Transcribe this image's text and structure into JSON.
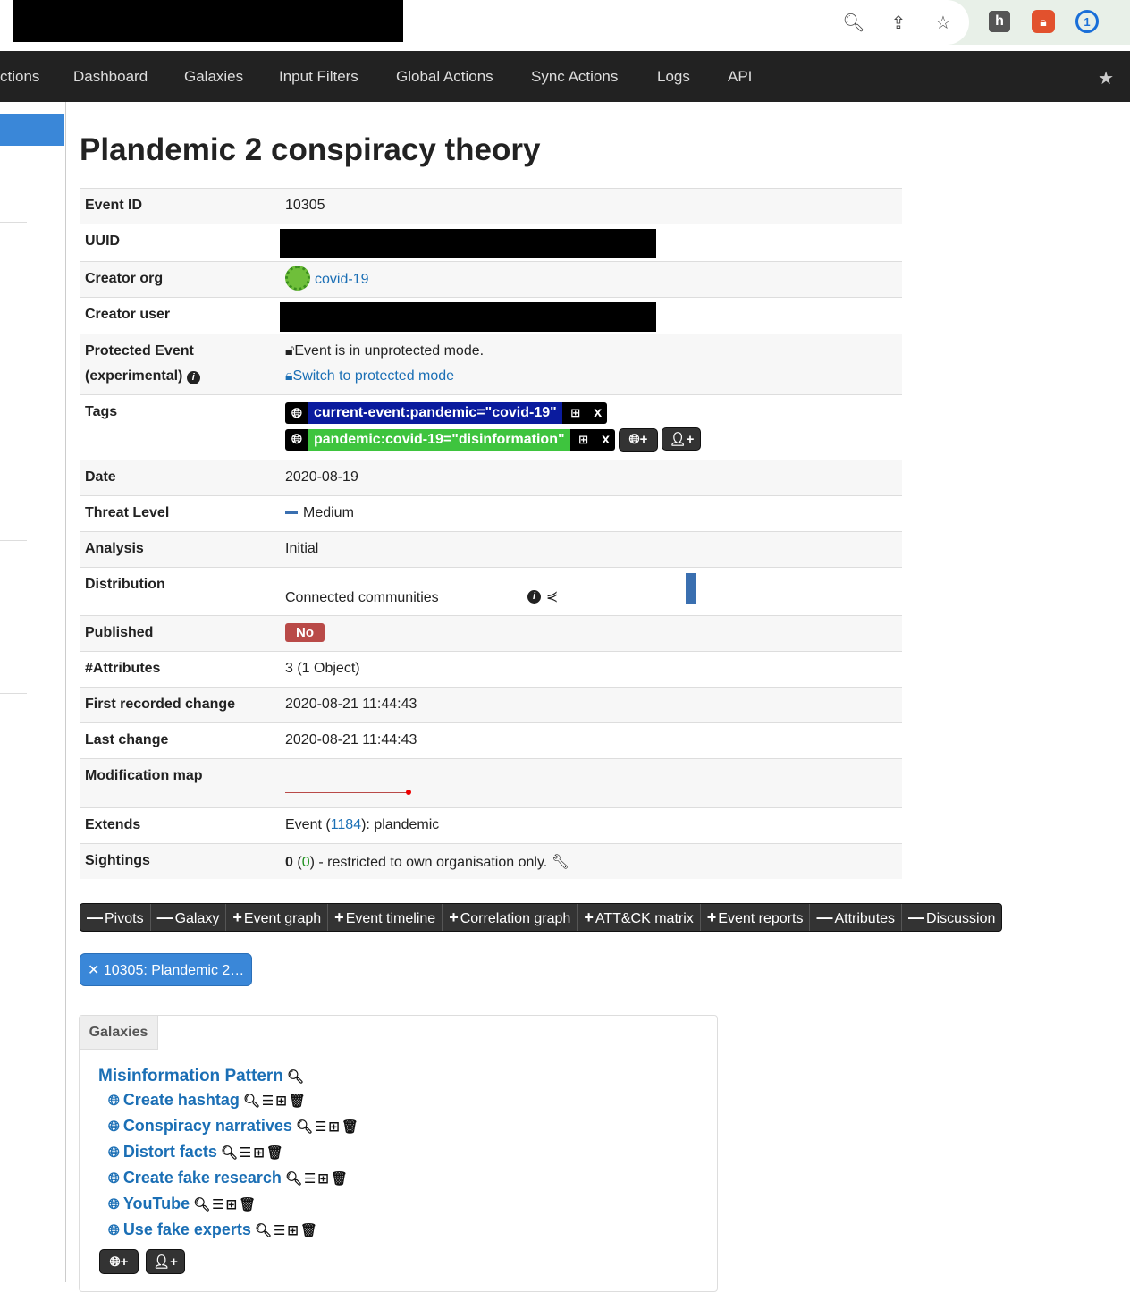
{
  "nav": {
    "items": [
      "ctions",
      "Dashboard",
      "Galaxies",
      "Input Filters",
      "Global Actions",
      "Sync Actions",
      "Logs",
      "API"
    ]
  },
  "page": {
    "title": "Plandemic 2 conspiracy theory"
  },
  "event": {
    "event_id_label": "Event ID",
    "event_id": "10305",
    "uuid_label": "UUID",
    "creator_org_label": "Creator org",
    "creator_org": "covid-19",
    "creator_user_label": "Creator user",
    "protected_label_1": "Protected Event",
    "protected_label_2": "(experimental)",
    "protected_status": "Event is in unprotected mode.",
    "protected_switch": "Switch to protected mode",
    "tags_label": "Tags",
    "tag_1": "current-event:pandemic=\"covid-19\"",
    "tag_2": "pandemic:covid-19=\"disinformation\"",
    "tag_remove": "x",
    "date_label": "Date",
    "date": "2020-08-19",
    "threat_label": "Threat Level",
    "threat": "Medium",
    "analysis_label": "Analysis",
    "analysis": "Initial",
    "distribution_label": "Distribution",
    "distribution": "Connected communities",
    "published_label": "Published",
    "published": "No",
    "attributes_label": "#Attributes",
    "attributes": "3 (1 Object)",
    "first_change_label": "First recorded change",
    "first_change": "2020-08-21 11:44:43",
    "last_change_label": "Last change",
    "last_change": "2020-08-21 11:44:43",
    "mod_map_label": "Modification map",
    "extends_label": "Extends",
    "extends_prefix": "Event (",
    "extends_id": "1184",
    "extends_suffix": "): plandemic",
    "sightings_label": "Sightings",
    "sightings_count": "0",
    "sightings_sub": "0",
    "sightings_text": " - restricted to own organisation only."
  },
  "tabs": [
    {
      "sign": "—",
      "label": "Pivots"
    },
    {
      "sign": "—",
      "label": "Galaxy"
    },
    {
      "sign": "+",
      "label": "Event graph"
    },
    {
      "sign": "+",
      "label": "Event timeline"
    },
    {
      "sign": "+",
      "label": "Correlation graph"
    },
    {
      "sign": "+",
      "label": "ATT&CK matrix"
    },
    {
      "sign": "+",
      "label": "Event reports"
    },
    {
      "sign": "—",
      "label": "Attributes"
    },
    {
      "sign": "—",
      "label": "Discussion"
    }
  ],
  "pivot_pill": "10305: Plandemic 2…",
  "galaxies": {
    "tab_label": "Galaxies",
    "title": "Misinformation Pattern",
    "items": [
      "Create hashtag",
      "Conspiracy narratives",
      "Distort facts",
      "Create fake research",
      "YouTube",
      "Use fake experts"
    ]
  }
}
